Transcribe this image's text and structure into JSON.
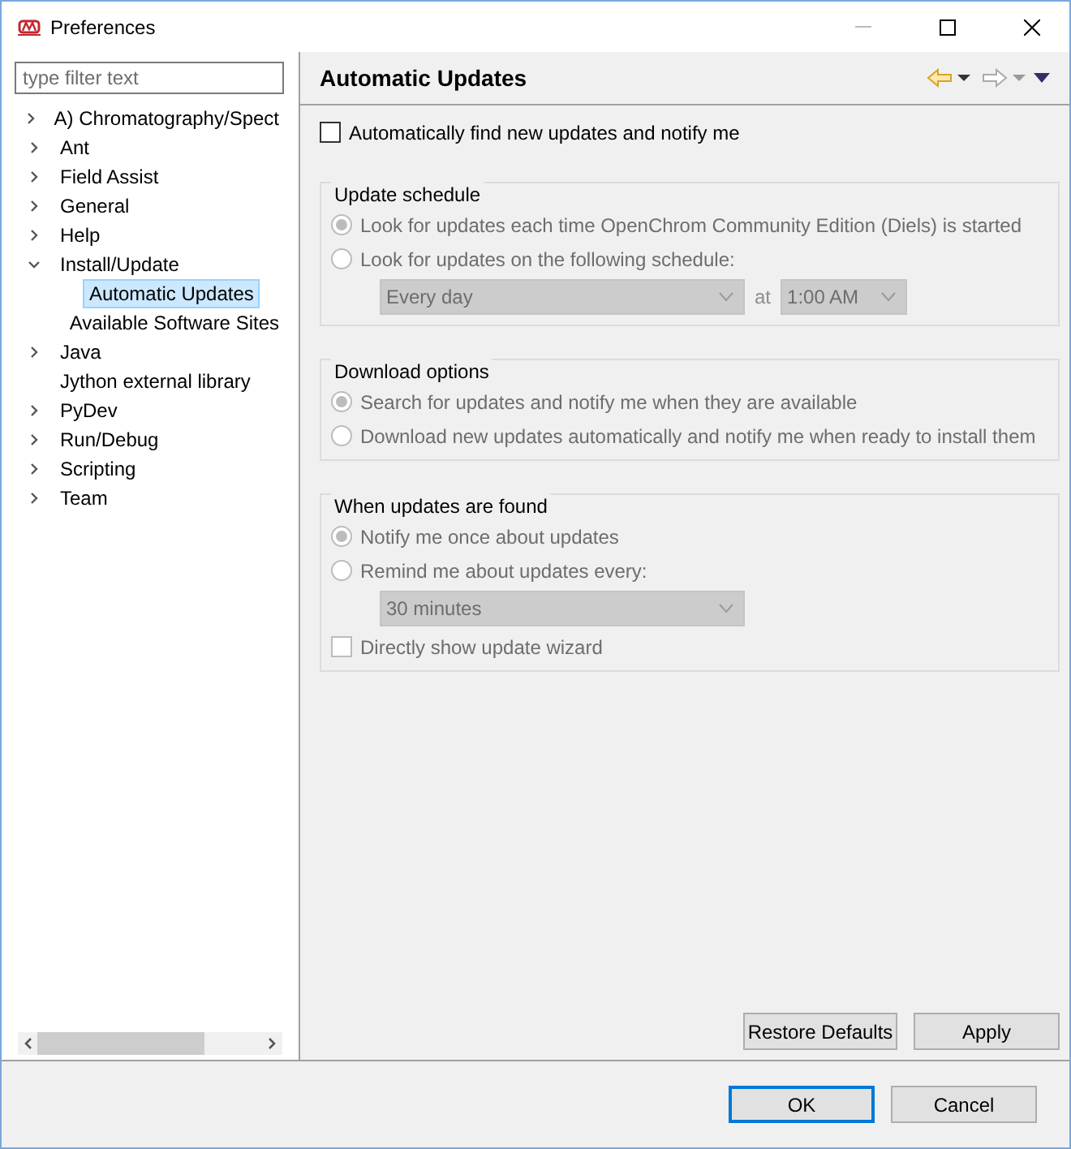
{
  "window": {
    "title": "Preferences"
  },
  "filter": {
    "placeholder": "type filter text"
  },
  "tree": [
    {
      "label": "A) Chromatography/Spect",
      "kind": "folder",
      "expanded": false,
      "selected": false
    },
    {
      "label": "Ant",
      "kind": "folder",
      "expanded": false,
      "selected": false
    },
    {
      "label": "Field Assist",
      "kind": "folder",
      "expanded": false,
      "selected": false
    },
    {
      "label": "General",
      "kind": "folder",
      "expanded": false,
      "selected": false
    },
    {
      "label": "Help",
      "kind": "folder",
      "expanded": false,
      "selected": false
    },
    {
      "label": "Install/Update",
      "kind": "folder",
      "expanded": true,
      "selected": false,
      "children": [
        {
          "label": "Automatic Updates",
          "selected": true
        },
        {
          "label": "Available Software Sites",
          "selected": false
        }
      ]
    },
    {
      "label": "Java",
      "kind": "folder",
      "expanded": false,
      "selected": false
    },
    {
      "label": "Jython external library",
      "kind": "leaf",
      "selected": false
    },
    {
      "label": "PyDev",
      "kind": "folder",
      "expanded": false,
      "selected": false
    },
    {
      "label": "Run/Debug",
      "kind": "folder",
      "expanded": false,
      "selected": false
    },
    {
      "label": "Scripting",
      "kind": "folder",
      "expanded": false,
      "selected": false
    },
    {
      "label": "Team",
      "kind": "folder",
      "expanded": false,
      "selected": false
    }
  ],
  "page": {
    "title": "Automatic Updates"
  },
  "auto_find": {
    "label": "Automatically find new updates and notify me",
    "checked": false
  },
  "groups": [
    {
      "title": "Update schedule",
      "disabled": true,
      "items": [
        {
          "kind": "radio",
          "label": "Look for updates each time OpenChrom Community Edition (Diels) is started",
          "selected": true
        },
        {
          "kind": "radio",
          "label": "Look for updates on the following schedule:",
          "selected": false
        },
        {
          "kind": "dropdowns",
          "fields": [
            {
              "value": "Every day"
            },
            {
              "value": "1:00 AM"
            }
          ],
          "separator": "at"
        }
      ]
    },
    {
      "title": "Download options",
      "disabled": true,
      "items": [
        {
          "kind": "radio",
          "label": "Search for updates and notify me when they are available",
          "selected": true
        },
        {
          "kind": "radio",
          "label": "Download new updates automatically and notify me when ready to install them",
          "selected": false
        }
      ]
    },
    {
      "title": "When updates are found",
      "disabled": true,
      "items": [
        {
          "kind": "radio",
          "label": "Notify me once about updates",
          "selected": true
        },
        {
          "kind": "radio",
          "label": "Remind me about updates every:",
          "selected": false
        },
        {
          "kind": "dropdowns",
          "fields": [
            {
              "value": "30 minutes"
            }
          ]
        },
        {
          "kind": "checkbox",
          "label": "Directly show update wizard",
          "checked": false
        }
      ]
    }
  ],
  "page_buttons": [
    "Restore Defaults",
    "Apply"
  ],
  "dialog_buttons": [
    {
      "label": "OK",
      "default": true
    },
    {
      "label": "Cancel",
      "default": false
    }
  ]
}
